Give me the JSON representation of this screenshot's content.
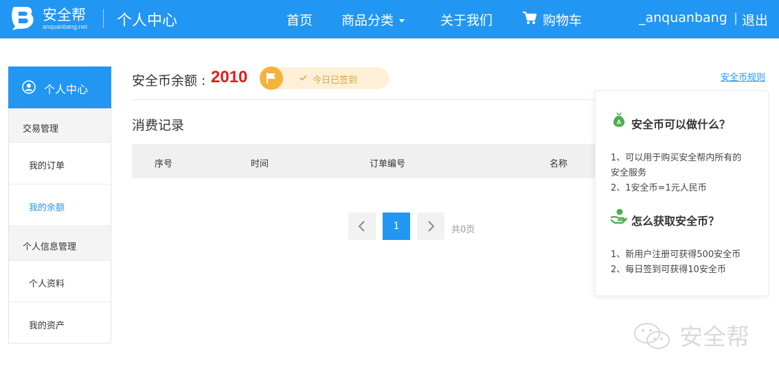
{
  "header": {
    "logo_name": "安全帮",
    "logo_sub": "anquanbang.net",
    "page_title": "个人中心",
    "nav": [
      {
        "label": "首页"
      },
      {
        "label": "商品分类"
      },
      {
        "label": "关于我们"
      },
      {
        "label": "购物车"
      }
    ],
    "username": "_anquanbang",
    "separator": "|",
    "logout_label": "退出"
  },
  "sidebar": {
    "title": "个人中心",
    "groups": [
      {
        "label": "交易管理",
        "items": [
          {
            "label": "我的订单",
            "active": false
          },
          {
            "label": "我的余额",
            "active": true
          }
        ]
      },
      {
        "label": "个人信息管理",
        "items": [
          {
            "label": "个人资料",
            "active": false
          },
          {
            "label": "我的资产",
            "active": false
          }
        ]
      }
    ]
  },
  "balance": {
    "label": "安全币余额 :",
    "value": "2010",
    "signed_text": "今日已签到",
    "rules_link": "安全币规则"
  },
  "records": {
    "title": "消费记录",
    "columns": [
      "序号",
      "时间",
      "订单编号",
      "名称"
    ],
    "rows": []
  },
  "pagination": {
    "current": "1",
    "total_text": "共0页"
  },
  "info": {
    "sections": [
      {
        "heading": "安全币可以做什么？",
        "icon": "money-bag-icon",
        "lines": [
          "1、可以用于购买安全帮内所有的",
          "安全服务",
          "2、1安全币=1元人民币"
        ]
      },
      {
        "heading": "怎么获取安全币？",
        "icon": "hand-coin-icon",
        "lines": [
          "1、新用户注册可获得500安全币",
          "2、每日签到可获得10安全币"
        ]
      }
    ]
  },
  "watermark": {
    "text": "安全帮"
  },
  "colors": {
    "primary": "#2196f3",
    "balance": "#e61a1a",
    "flag": "#f4b33d",
    "signed_bg": "#fdf0d7",
    "icon_green": "#4caf50"
  }
}
